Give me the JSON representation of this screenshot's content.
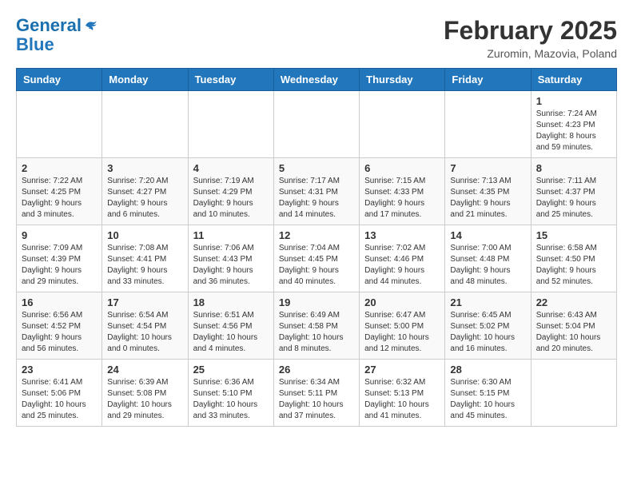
{
  "logo": {
    "line1": "General",
    "line2": "Blue"
  },
  "title": "February 2025",
  "subtitle": "Zuromin, Mazovia, Poland",
  "header": {
    "days": [
      "Sunday",
      "Monday",
      "Tuesday",
      "Wednesday",
      "Thursday",
      "Friday",
      "Saturday"
    ]
  },
  "weeks": [
    {
      "cells": [
        {
          "day": "",
          "details": ""
        },
        {
          "day": "",
          "details": ""
        },
        {
          "day": "",
          "details": ""
        },
        {
          "day": "",
          "details": ""
        },
        {
          "day": "",
          "details": ""
        },
        {
          "day": "",
          "details": ""
        },
        {
          "day": "1",
          "details": "Sunrise: 7:24 AM\nSunset: 4:23 PM\nDaylight: 8 hours and 59 minutes."
        }
      ]
    },
    {
      "cells": [
        {
          "day": "2",
          "details": "Sunrise: 7:22 AM\nSunset: 4:25 PM\nDaylight: 9 hours and 3 minutes."
        },
        {
          "day": "3",
          "details": "Sunrise: 7:20 AM\nSunset: 4:27 PM\nDaylight: 9 hours and 6 minutes."
        },
        {
          "day": "4",
          "details": "Sunrise: 7:19 AM\nSunset: 4:29 PM\nDaylight: 9 hours and 10 minutes."
        },
        {
          "day": "5",
          "details": "Sunrise: 7:17 AM\nSunset: 4:31 PM\nDaylight: 9 hours and 14 minutes."
        },
        {
          "day": "6",
          "details": "Sunrise: 7:15 AM\nSunset: 4:33 PM\nDaylight: 9 hours and 17 minutes."
        },
        {
          "day": "7",
          "details": "Sunrise: 7:13 AM\nSunset: 4:35 PM\nDaylight: 9 hours and 21 minutes."
        },
        {
          "day": "8",
          "details": "Sunrise: 7:11 AM\nSunset: 4:37 PM\nDaylight: 9 hours and 25 minutes."
        }
      ]
    },
    {
      "cells": [
        {
          "day": "9",
          "details": "Sunrise: 7:09 AM\nSunset: 4:39 PM\nDaylight: 9 hours and 29 minutes."
        },
        {
          "day": "10",
          "details": "Sunrise: 7:08 AM\nSunset: 4:41 PM\nDaylight: 9 hours and 33 minutes."
        },
        {
          "day": "11",
          "details": "Sunrise: 7:06 AM\nSunset: 4:43 PM\nDaylight: 9 hours and 36 minutes."
        },
        {
          "day": "12",
          "details": "Sunrise: 7:04 AM\nSunset: 4:45 PM\nDaylight: 9 hours and 40 minutes."
        },
        {
          "day": "13",
          "details": "Sunrise: 7:02 AM\nSunset: 4:46 PM\nDaylight: 9 hours and 44 minutes."
        },
        {
          "day": "14",
          "details": "Sunrise: 7:00 AM\nSunset: 4:48 PM\nDaylight: 9 hours and 48 minutes."
        },
        {
          "day": "15",
          "details": "Sunrise: 6:58 AM\nSunset: 4:50 PM\nDaylight: 9 hours and 52 minutes."
        }
      ]
    },
    {
      "cells": [
        {
          "day": "16",
          "details": "Sunrise: 6:56 AM\nSunset: 4:52 PM\nDaylight: 9 hours and 56 minutes."
        },
        {
          "day": "17",
          "details": "Sunrise: 6:54 AM\nSunset: 4:54 PM\nDaylight: 10 hours and 0 minutes."
        },
        {
          "day": "18",
          "details": "Sunrise: 6:51 AM\nSunset: 4:56 PM\nDaylight: 10 hours and 4 minutes."
        },
        {
          "day": "19",
          "details": "Sunrise: 6:49 AM\nSunset: 4:58 PM\nDaylight: 10 hours and 8 minutes."
        },
        {
          "day": "20",
          "details": "Sunrise: 6:47 AM\nSunset: 5:00 PM\nDaylight: 10 hours and 12 minutes."
        },
        {
          "day": "21",
          "details": "Sunrise: 6:45 AM\nSunset: 5:02 PM\nDaylight: 10 hours and 16 minutes."
        },
        {
          "day": "22",
          "details": "Sunrise: 6:43 AM\nSunset: 5:04 PM\nDaylight: 10 hours and 20 minutes."
        }
      ]
    },
    {
      "cells": [
        {
          "day": "23",
          "details": "Sunrise: 6:41 AM\nSunset: 5:06 PM\nDaylight: 10 hours and 25 minutes."
        },
        {
          "day": "24",
          "details": "Sunrise: 6:39 AM\nSunset: 5:08 PM\nDaylight: 10 hours and 29 minutes."
        },
        {
          "day": "25",
          "details": "Sunrise: 6:36 AM\nSunset: 5:10 PM\nDaylight: 10 hours and 33 minutes."
        },
        {
          "day": "26",
          "details": "Sunrise: 6:34 AM\nSunset: 5:11 PM\nDaylight: 10 hours and 37 minutes."
        },
        {
          "day": "27",
          "details": "Sunrise: 6:32 AM\nSunset: 5:13 PM\nDaylight: 10 hours and 41 minutes."
        },
        {
          "day": "28",
          "details": "Sunrise: 6:30 AM\nSunset: 5:15 PM\nDaylight: 10 hours and 45 minutes."
        },
        {
          "day": "",
          "details": ""
        }
      ]
    }
  ]
}
